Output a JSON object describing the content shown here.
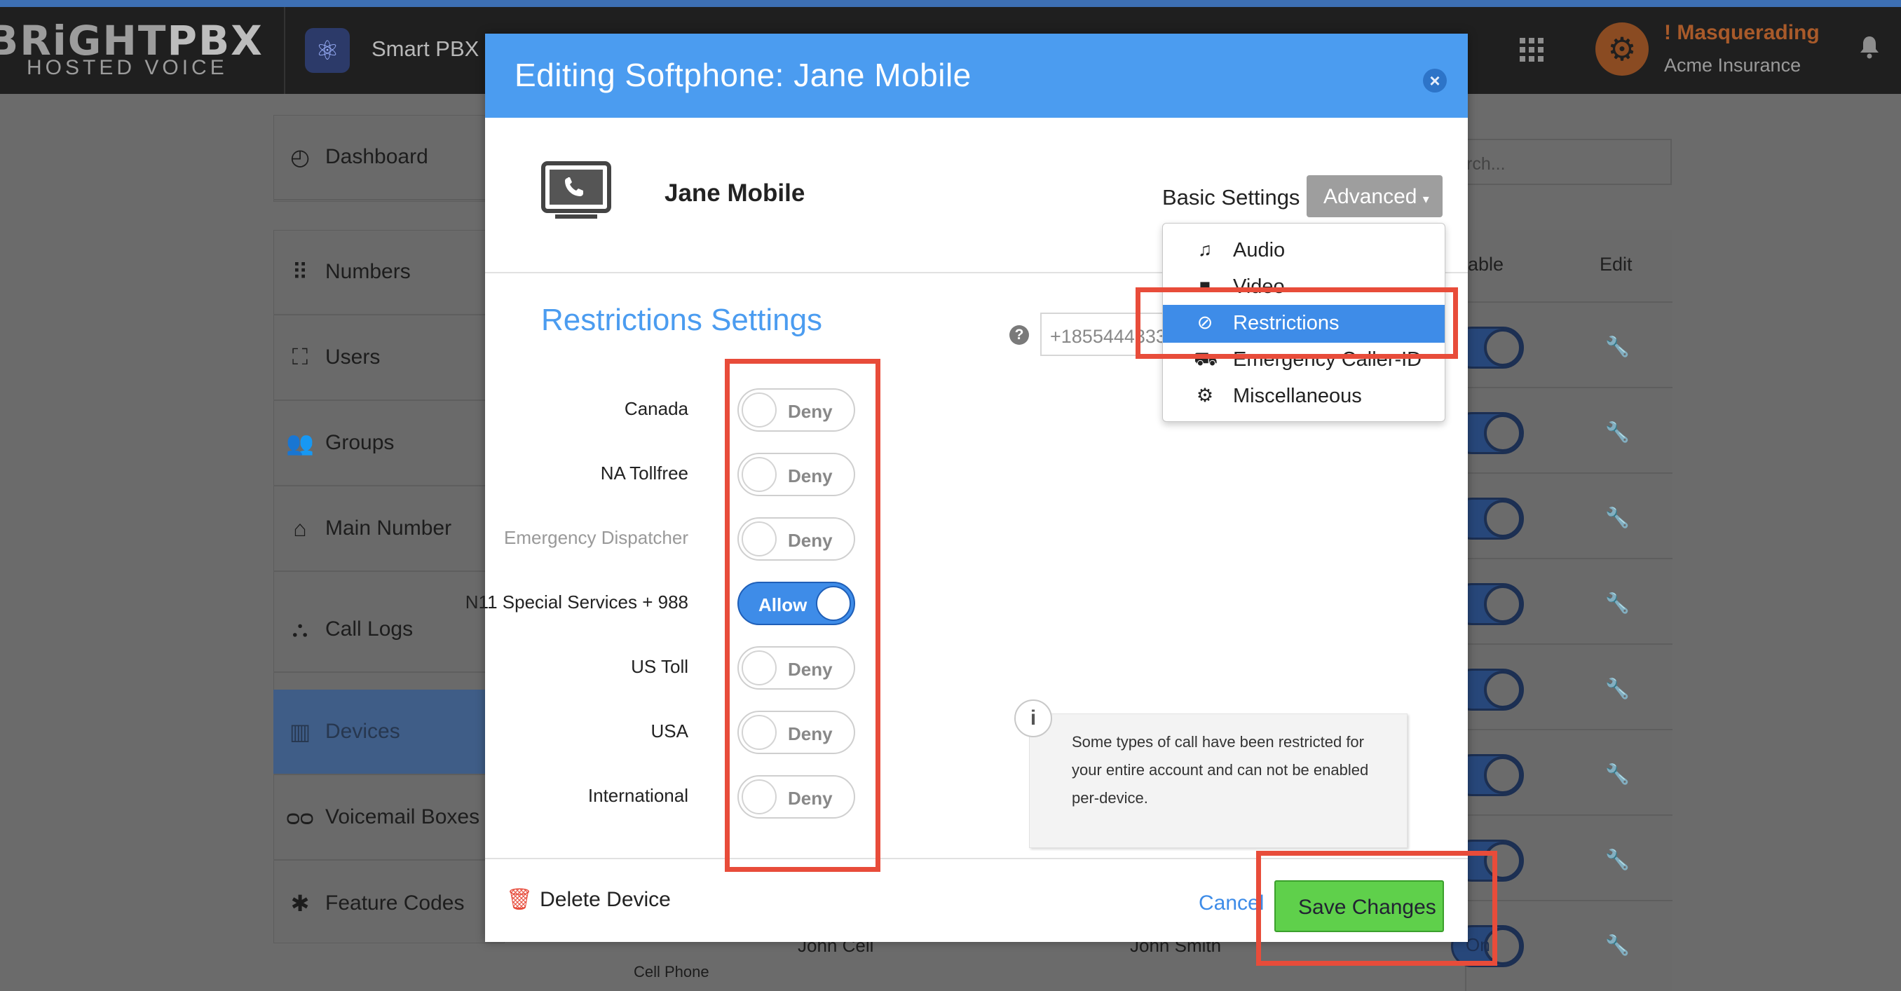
{
  "topbar": {
    "logo_line1_a": "BRiGHT",
    "logo_line1_b": "PBX",
    "logo_line2": "HOSTED VOICE",
    "app_name": "Smart PBX",
    "masquerading": "! Masquerading",
    "account": "Acme Insurance"
  },
  "sidebar": {
    "items": [
      {
        "label": "Dashboard",
        "icon": "gauge-icon"
      },
      {
        "label": "Numbers",
        "icon": "grid-icon"
      },
      {
        "label": "Users",
        "icon": "users-icon"
      },
      {
        "label": "Groups",
        "icon": "group-icon"
      },
      {
        "label": "Main Number",
        "icon": "home-icon"
      },
      {
        "label": "Call Logs",
        "icon": "network-icon"
      },
      {
        "label": "Devices",
        "icon": "fax-icon"
      },
      {
        "label": "Voicemail Boxes",
        "icon": "voicemail-icon"
      },
      {
        "label": "Feature Codes",
        "icon": "asterisk-icon"
      }
    ]
  },
  "background_table": {
    "search_placeholder": "rch...",
    "col_enable": "able",
    "col_edit": "Edit",
    "toggle_text": "n",
    "last_toggle_text": "On",
    "bottom_device_type": "Cell Phone",
    "bottom_name": "John Cell",
    "bottom_user": "John Smith"
  },
  "modal": {
    "title": "Editing Softphone: Jane Mobile",
    "device_name": "Jane Mobile",
    "basic_settings": "Basic Settings",
    "advanced": "Advanced",
    "section_title": "Restrictions Settings",
    "number_value": "+1855444333",
    "restrictions": [
      {
        "label": "Canada",
        "state": "Deny",
        "on": false,
        "muted": false
      },
      {
        "label": "NA Tollfree",
        "state": "Deny",
        "on": false,
        "muted": false
      },
      {
        "label": "Emergency Dispatcher",
        "state": "Deny",
        "on": false,
        "muted": true
      },
      {
        "label": "N11 Special Services + 988",
        "state": "Allow",
        "on": true,
        "muted": false
      },
      {
        "label": "US Toll",
        "state": "Deny",
        "on": false,
        "muted": false
      },
      {
        "label": "USA",
        "state": "Deny",
        "on": false,
        "muted": false
      },
      {
        "label": "International",
        "state": "Deny",
        "on": false,
        "muted": false
      }
    ],
    "info_text": "Some types of call have been restricted for your entire account and can not be enabled per-device.",
    "delete_device": "Delete Device",
    "cancel": "Cancel",
    "save": "Save Changes"
  },
  "advanced_menu": {
    "items": [
      {
        "label": "Audio",
        "icon": "music-note-icon"
      },
      {
        "label": "Video",
        "icon": "video-camera-icon"
      },
      {
        "label": "Restrictions",
        "icon": "ban-icon",
        "selected": true
      },
      {
        "label": "Emergency Caller-ID",
        "icon": "ambulance-icon"
      },
      {
        "label": "Miscellaneous",
        "icon": "cogs-icon"
      }
    ]
  },
  "colors": {
    "modal_header": "#4b9cf0",
    "accent_blue": "#3e8ce8",
    "save_green": "#5fd04b",
    "highlight_red": "#e84c3a",
    "masquerade_orange": "#a85a2a"
  }
}
